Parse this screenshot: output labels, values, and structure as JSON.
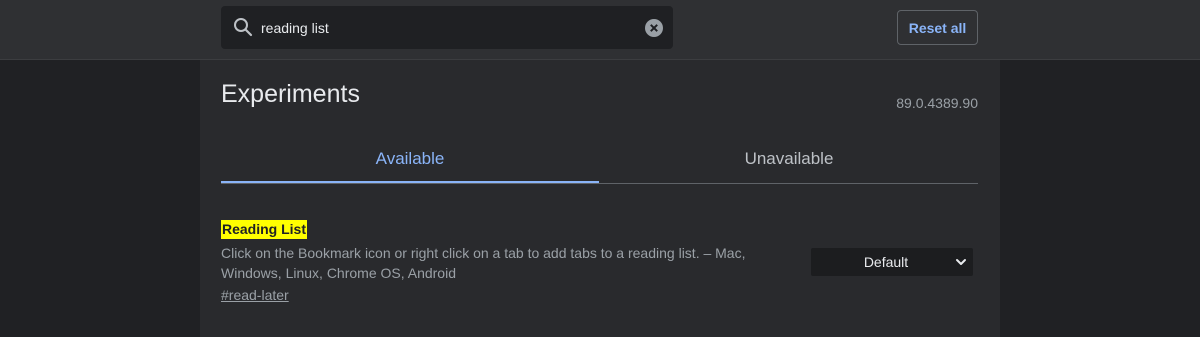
{
  "search": {
    "value": "reading list",
    "icon": "search-icon",
    "clear_icon": "close-icon"
  },
  "header": {
    "reset_label": "Reset all"
  },
  "main": {
    "title": "Experiments",
    "version": "89.0.4389.90",
    "tabs": [
      {
        "label": "Available",
        "active": true
      },
      {
        "label": "Unavailable",
        "active": false
      }
    ],
    "experiments": [
      {
        "name": "Reading List",
        "description": "Click on the Bookmark icon or right click on a tab to add tabs to a reading list. – Mac, Windows, Linux, Chrome OS, Android",
        "link": "#read-later",
        "selected": "Default"
      }
    ]
  },
  "colors": {
    "background": "#202124",
    "panel": "#292a2d",
    "accent": "#8ab4f8",
    "highlight": "#ffff00"
  }
}
